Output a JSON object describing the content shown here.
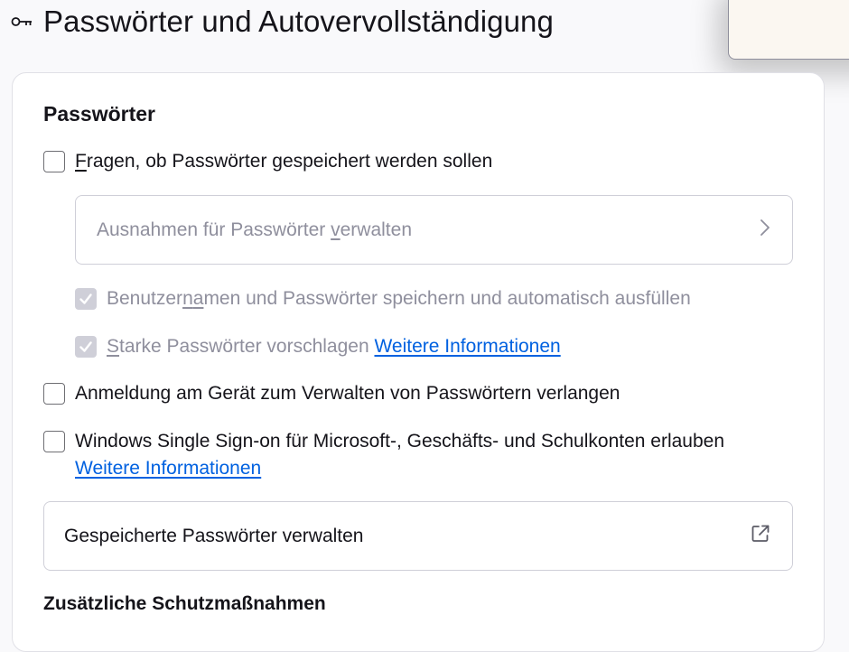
{
  "header": {
    "title": "Passwörter und Autovervollständigung",
    "icon": "key-icon"
  },
  "passwords": {
    "section_title": "Passwörter",
    "ask_to_save": {
      "label_first": "F",
      "label_rest": "ragen, ob Passwörter gespeichert werden sollen",
      "checked": false
    },
    "exceptions_button": {
      "label_prefix": "Ausnahmen für Passwörter ",
      "label_underlined": "v",
      "label_suffix": "erwalten",
      "icon": "chevron-right-icon"
    },
    "autofill": {
      "label_prefix": "Benutzer",
      "label_underlined": "n",
      "label_mid": "a",
      "label_rest": "men und Passwörter speichern und automatisch ausfüllen",
      "checked": true,
      "disabled": true
    },
    "suggest_strong": {
      "label_first": "S",
      "label_rest": "tarke Passwörter vorschlagen ",
      "link": "Weitere Informationen",
      "checked": true,
      "disabled": true
    },
    "require_device_login": {
      "label": "Anmeldung am Gerät zum Verwalten von Passwörtern verlangen",
      "checked": false
    },
    "windows_sso": {
      "label": "Windows Single Sign-on für Microsoft-, Geschäfts- und Schulkonten erlauben",
      "link": "Weitere Informationen",
      "checked": false
    },
    "manage_saved_button": {
      "label": "Gespeicherte Passwörter verwalten",
      "icon": "external-link-icon"
    }
  },
  "additional_protection": {
    "section_title": "Zusätzliche Schutzmaßnahmen"
  },
  "colors": {
    "accent_link": "#0061e0",
    "disabled_text": "#8f8f9d",
    "card_background": "#ffffff",
    "page_background": "#f9f9fb"
  }
}
